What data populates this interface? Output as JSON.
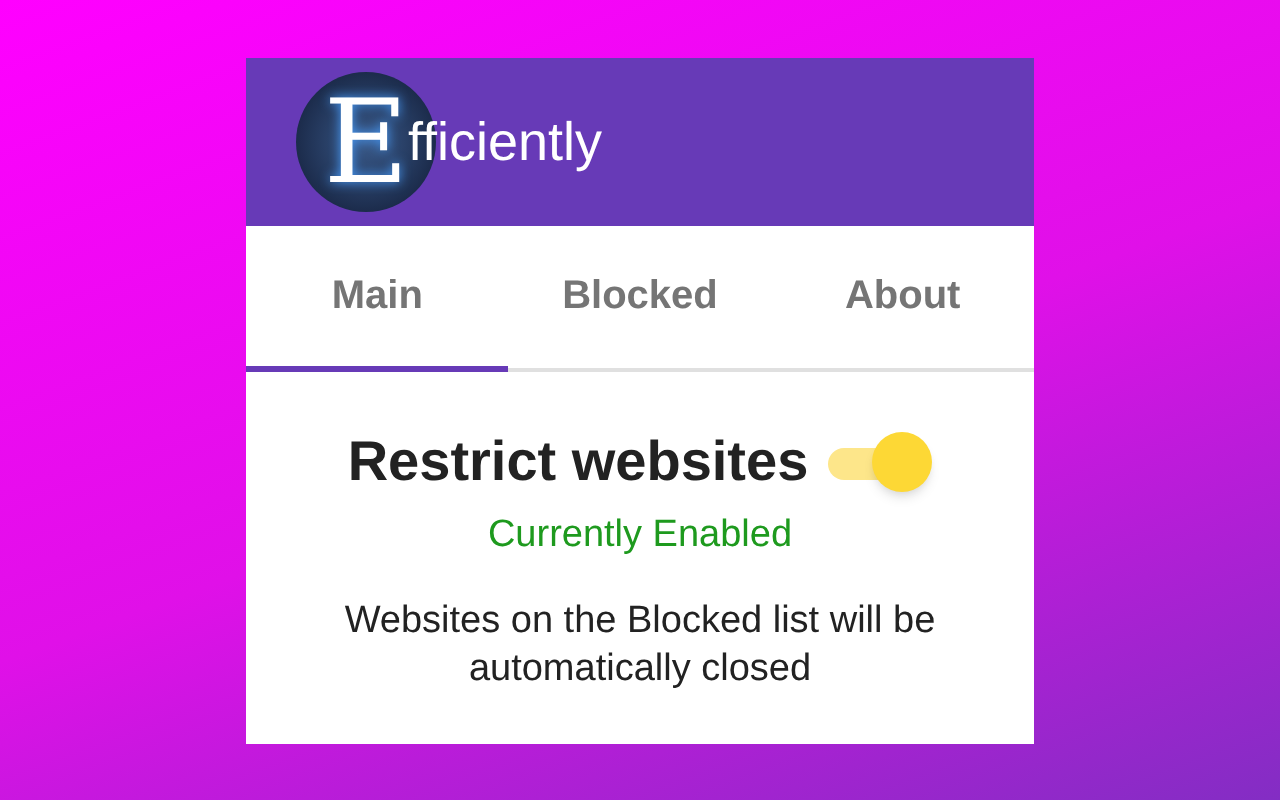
{
  "header": {
    "logo_letter": "E",
    "title": "fficiently"
  },
  "tabs": [
    {
      "label": "Main",
      "selected": true
    },
    {
      "label": "Blocked",
      "selected": false
    },
    {
      "label": "About",
      "selected": false
    }
  ],
  "restrict": {
    "label": "Restrict websites",
    "on": true,
    "status": "Currently Enabled",
    "description": "Websites on the Blocked list will be automatically closed"
  }
}
